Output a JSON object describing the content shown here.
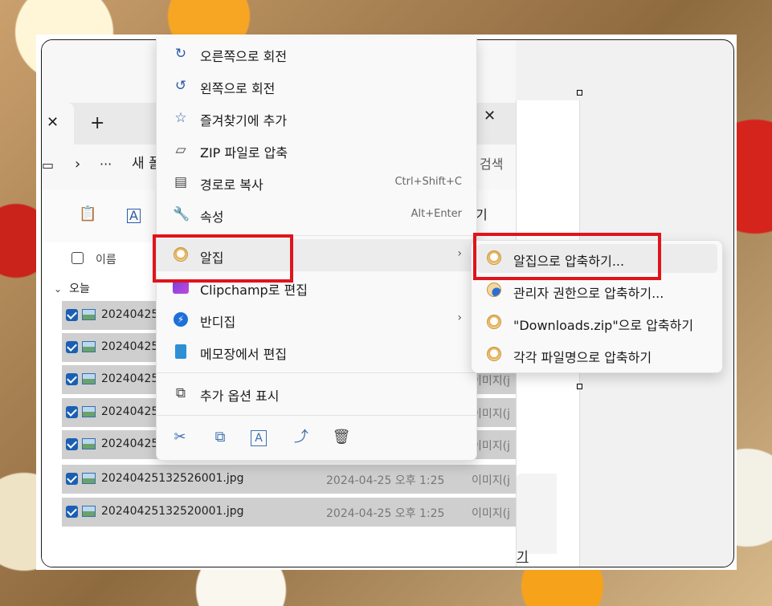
{
  "tabs": {
    "new_tab": "+"
  },
  "address": {
    "crumb": "새 폴",
    "more": "···",
    "search": "검색"
  },
  "toolbar": {
    "right_label": "기"
  },
  "list": {
    "header_name": "이름",
    "group_today": "오늘",
    "rows": [
      {
        "name": "202404251",
        "type": ""
      },
      {
        "name": "202404251",
        "type": ""
      },
      {
        "name": "202404251",
        "type": "이미지(j"
      },
      {
        "name": "202404251",
        "type": "이미지(j"
      },
      {
        "name": "202404251",
        "type": "이미지(j"
      },
      {
        "name": "20240425132526001.jpg",
        "date": "2024-04-25 오후 1:25",
        "type": "이미지(j"
      },
      {
        "name": "20240425132520001.jpg",
        "date": "2024-04-25 오후 1:25",
        "type": "이미지(j"
      }
    ]
  },
  "right_pane": {
    "fragment": "기"
  },
  "context_menu": {
    "items": [
      {
        "label": "오른쪽으로 회전",
        "icon": "rotate-right-icon"
      },
      {
        "label": "왼쪽으로 회전",
        "icon": "rotate-left-icon"
      },
      {
        "label": "즐겨찾기에 추가",
        "icon": "star-icon"
      },
      {
        "label": "ZIP 파일로 압축",
        "icon": "zip-folder-icon"
      },
      {
        "label": "경로로 복사",
        "shortcut": "Ctrl+Shift+C",
        "icon": "copy-path-icon"
      },
      {
        "label": "속성",
        "shortcut": "Alt+Enter",
        "icon": "wrench-icon"
      },
      {
        "label": "알집",
        "icon": "alzip-icon"
      },
      {
        "label": "Clipchamp로 편집",
        "icon": "clipchamp-icon"
      },
      {
        "label": "반디집",
        "icon": "bandizip-icon"
      },
      {
        "label": "메모장에서 편집",
        "icon": "notepad-icon"
      },
      {
        "label": "추가 옵션 표시",
        "icon": "more-options-icon"
      }
    ],
    "arrow": "›"
  },
  "submenu": {
    "items": [
      {
        "label": "알집으로 압축하기..."
      },
      {
        "label": "관리자 권한으로 압축하기..."
      },
      {
        "label": "\"Downloads.zip\"으로 압축하기"
      },
      {
        "label": "각각 파일명으로 압축하기"
      }
    ]
  },
  "colors": {
    "highlight": "#e0141b",
    "accent": "#1a5fb4"
  }
}
